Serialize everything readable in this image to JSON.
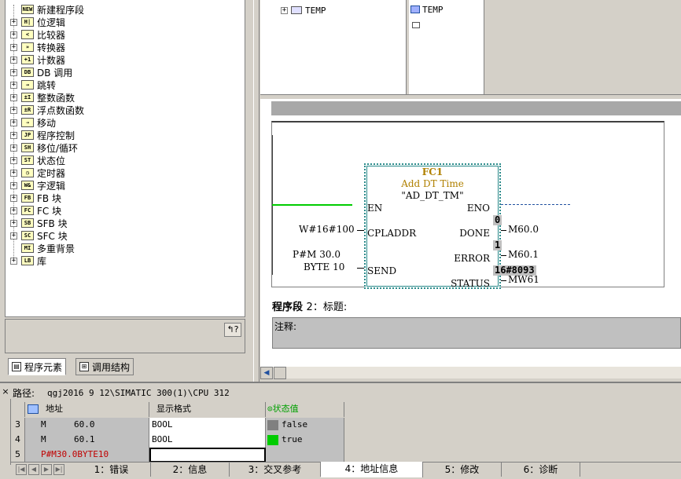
{
  "tree": {
    "items": [
      {
        "label": "新建程序段",
        "icon": "new-network-icon",
        "glyph": "NEW",
        "expandable": false
      },
      {
        "label": "位逻辑",
        "icon": "bit-logic-icon",
        "glyph": "H|",
        "expandable": true
      },
      {
        "label": "比较器",
        "icon": "comparator-icon",
        "glyph": "<",
        "expandable": true
      },
      {
        "label": "转换器",
        "icon": "converter-icon",
        "glyph": "»",
        "expandable": true
      },
      {
        "label": "计数器",
        "icon": "counter-icon",
        "glyph": "+1",
        "expandable": true
      },
      {
        "label": "DB 调用",
        "icon": "db-call-icon",
        "glyph": "DB",
        "expandable": true
      },
      {
        "label": "跳转",
        "icon": "jump-icon",
        "glyph": "→",
        "expandable": true
      },
      {
        "label": "整数函数",
        "icon": "integer-func-icon",
        "glyph": "±I",
        "expandable": true
      },
      {
        "label": "浮点数函数",
        "icon": "float-func-icon",
        "glyph": "±R",
        "expandable": true
      },
      {
        "label": "移动",
        "icon": "move-icon",
        "glyph": "⇢",
        "expandable": true
      },
      {
        "label": "程序控制",
        "icon": "program-control-icon",
        "glyph": "JP",
        "expandable": true
      },
      {
        "label": "移位/循环",
        "icon": "shift-rotate-icon",
        "glyph": "SH",
        "expandable": true
      },
      {
        "label": "状态位",
        "icon": "status-bit-icon",
        "glyph": "ST",
        "expandable": true
      },
      {
        "label": "定时器",
        "icon": "timer-icon",
        "glyph": "◷",
        "expandable": true
      },
      {
        "label": "字逻辑",
        "icon": "word-logic-icon",
        "glyph": "W&",
        "expandable": true
      },
      {
        "label": "FB 块",
        "icon": "fb-block-icon",
        "glyph": "FB",
        "expandable": true
      },
      {
        "label": "FC 块",
        "icon": "fc-block-icon",
        "glyph": "FC",
        "expandable": true
      },
      {
        "label": "SFB 块",
        "icon": "sfb-block-icon",
        "glyph": "SB",
        "expandable": true
      },
      {
        "label": "SFC 块",
        "icon": "sfc-block-icon",
        "glyph": "SC",
        "expandable": true
      },
      {
        "label": "多重背景",
        "icon": "multi-instance-icon",
        "glyph": "MI",
        "expandable": false
      },
      {
        "label": "库",
        "icon": "library-icon",
        "glyph": "LB",
        "expandable": true
      }
    ]
  },
  "left_tabs": {
    "program_elements": "程序元素",
    "call_structure": "调用结构"
  },
  "declaration": {
    "left_item": "TEMP",
    "right_item": "TEMP"
  },
  "network1": {
    "block_name": "FC1",
    "block_comment": "Add DT Time",
    "block_symbol": "\"AD_DT_TM\"",
    "pins_in": {
      "en": "EN",
      "cpladdr": "CPLADDR",
      "send": "SEND"
    },
    "pins_out": {
      "eno": "ENO",
      "done": "DONE",
      "error": "ERROR",
      "status": "STATUS"
    },
    "params": {
      "cpladdr": "W#16#100",
      "send_line1": "P#M 30.0",
      "send_line2": "BYTE 10",
      "done": "M60.0",
      "error": "M60.1",
      "status": "MW61"
    },
    "status_values": {
      "done": "0",
      "error": "1",
      "status": "16#8093"
    },
    "colors": {
      "power_flow": "#00cc00",
      "block_border": "#2a8a8a",
      "block_title": "#b08000"
    }
  },
  "network2": {
    "title_prefix": "程序段",
    "number": "2",
    "title_suffix": "：标题:",
    "comment_label": "注释:"
  },
  "bottom": {
    "path_label": "路径:",
    "path_value": "qgj2016 9 12\\SIMATIC 300(1)\\CPU 312",
    "headers": {
      "address": "地址",
      "format": "显示格式",
      "status": "状态值"
    },
    "rows": [
      {
        "num": "3",
        "area": "M",
        "addr": "60.0",
        "format": "BOOL",
        "value": "false",
        "swatch": "#808080"
      },
      {
        "num": "4",
        "area": "M",
        "addr": "60.1",
        "format": "BOOL",
        "value": "true",
        "swatch": "#00cc00"
      },
      {
        "num": "5",
        "area": "P#M30.0BYTE10",
        "addr": "",
        "format": "",
        "value": "",
        "swatch": ""
      }
    ],
    "tabs": [
      "1：错误",
      "2：信息",
      "3：交叉参考",
      "4：地址信息",
      "5：修改",
      "6：诊断"
    ],
    "active_tab": "4：地址信息"
  }
}
